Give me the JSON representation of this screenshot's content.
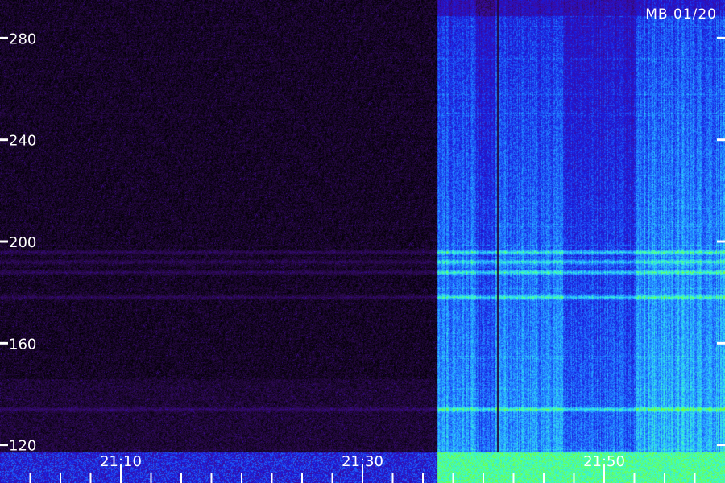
{
  "chart_data": {
    "type": "heatmap",
    "title": "",
    "station_label": "MB 01/20",
    "xlabel": "",
    "ylabel": "",
    "x_axis": {
      "kind": "time",
      "range": [
        "21:00",
        "21:60"
      ],
      "range_minutes": [
        0,
        60
      ],
      "major_tick_labels": [
        "21:10",
        "21:30",
        "21:50"
      ],
      "major_tick_minutes": [
        10,
        30,
        50
      ],
      "minor_tick_minutes": [
        2.5,
        5,
        7.5,
        12.5,
        15,
        17.5,
        20,
        22.5,
        25,
        27.5,
        32.5,
        35,
        37.5,
        40,
        42.5,
        45,
        47.5,
        52.5,
        55,
        57.5
      ]
    },
    "y_axis": {
      "range": [
        105,
        295
      ],
      "tick_labels": [
        "280",
        "240",
        "200",
        "160",
        "120"
      ],
      "tick_values": [
        280,
        240,
        200,
        160,
        120
      ]
    },
    "regions": [
      {
        "name": "quiet",
        "x_start_min": 0,
        "x_end_min": 36.2,
        "level": 0.05
      },
      {
        "name": "active",
        "x_start_min": 36.2,
        "x_end_min": 60,
        "level": 0.55
      }
    ],
    "horizontal_bands_y": [
      188,
      192,
      196,
      178,
      134
    ],
    "grid": false,
    "legend": "none",
    "colors": {
      "background": "#000000",
      "quiet": "#2a0a4a",
      "low": "#1a1acc",
      "mid": "#1f6bff",
      "high": "#2ee6ff",
      "peak": "#7cff2e",
      "axis_text": "#ffffff"
    }
  }
}
